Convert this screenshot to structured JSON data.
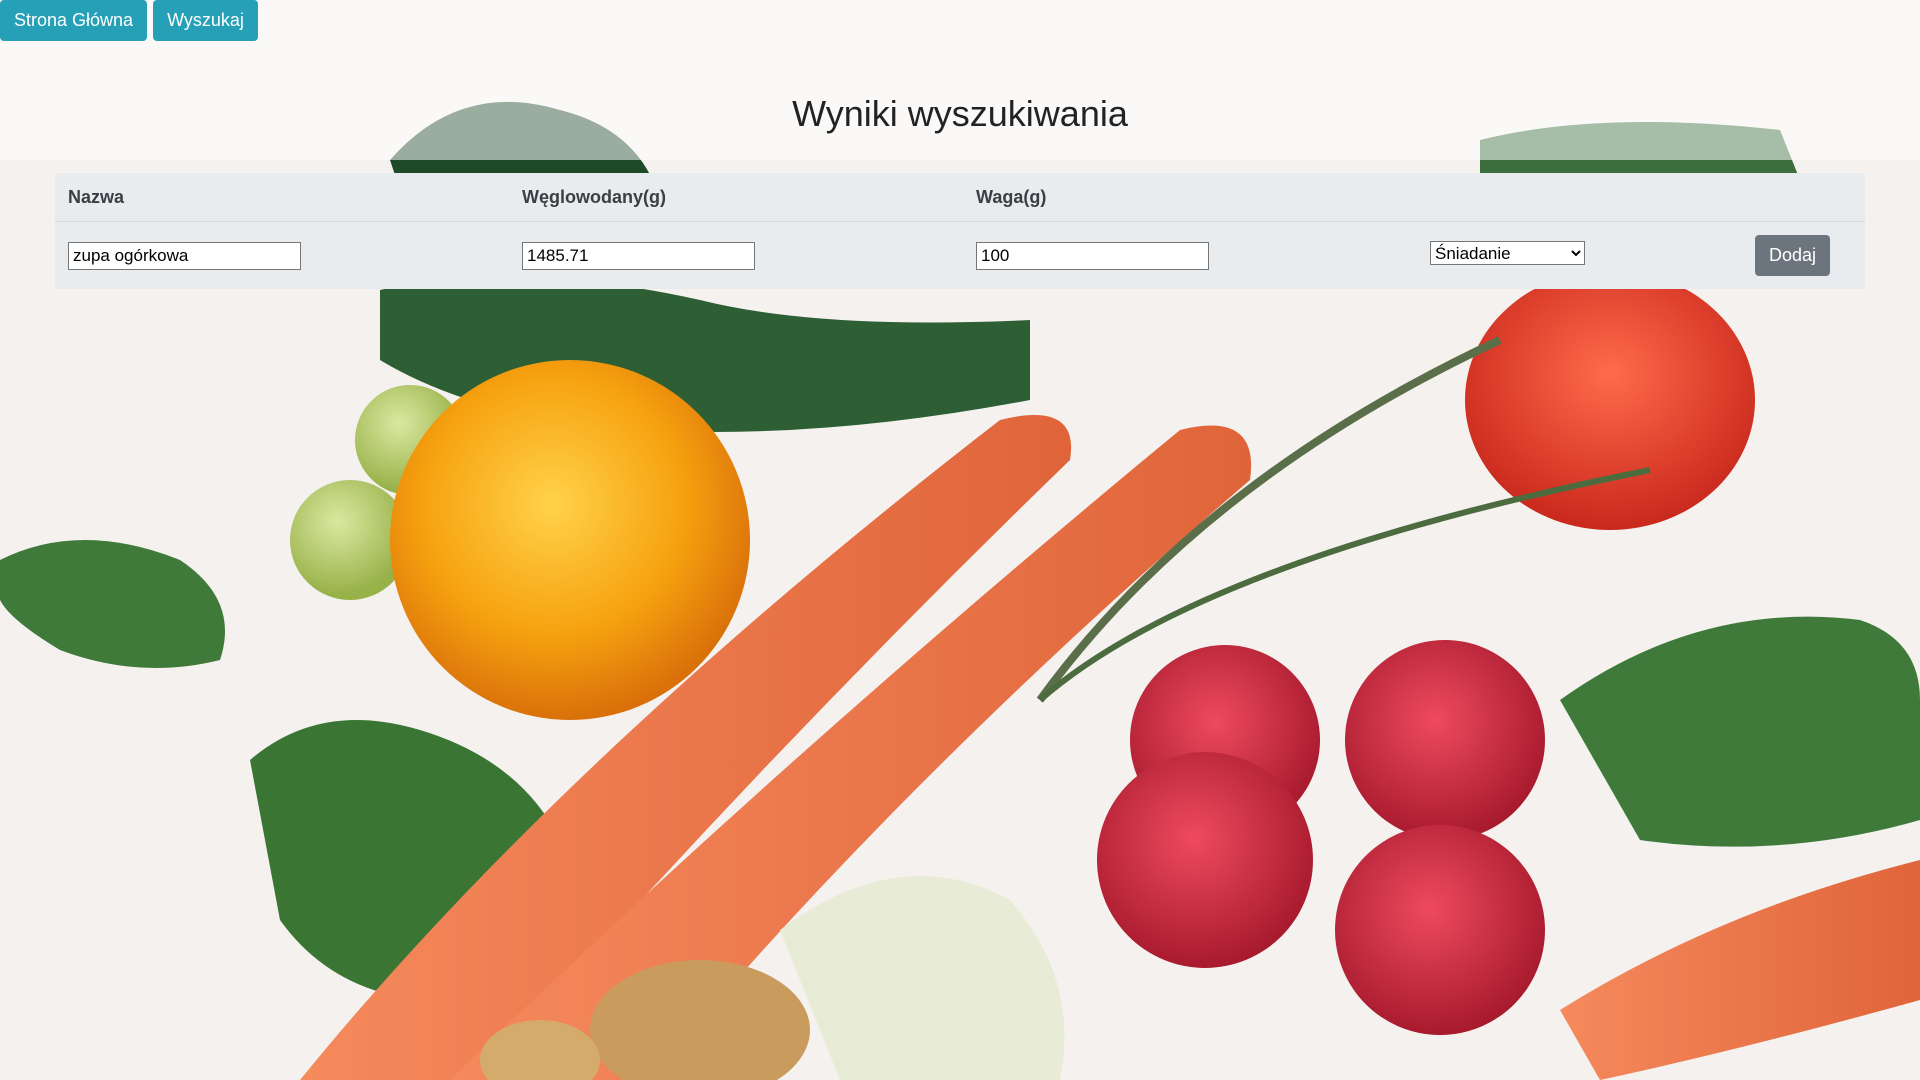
{
  "nav": {
    "home_label": "Strona Główna",
    "search_label": "Wyszukaj"
  },
  "page": {
    "title": "Wyniki wyszukiwania"
  },
  "table": {
    "headers": [
      "Nazwa",
      "Węglowodany(g)",
      "Waga(g)",
      "",
      ""
    ],
    "rows": [
      {
        "name": "zupa ogórkowa",
        "carbs": "1485.71",
        "weight": "100",
        "meal": "Śniadanie",
        "add_label": "Dodaj"
      }
    ]
  },
  "colors": {
    "nav_button": "#26a0b6",
    "add_button": "#6c757d",
    "table_bg": "#e9ecef"
  },
  "background": {
    "icon": "vegetables-photo"
  }
}
